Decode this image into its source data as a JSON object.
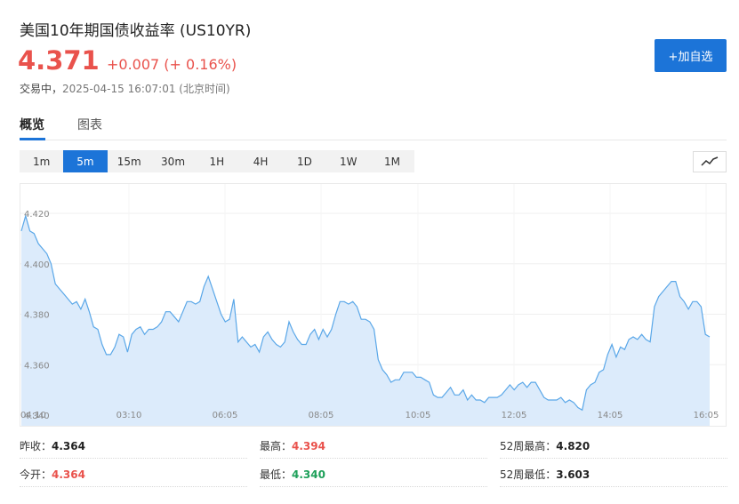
{
  "header": {
    "title": "美国10年期国债收益率  (US10YR)",
    "price": "4.371",
    "change": "+0.007 (+ 0.16%)",
    "status_prefix": "交易中，",
    "status_time": "2025-04-15 16:07:01 (北京时间)",
    "add_button": "+加自选"
  },
  "tabs": [
    {
      "label": "概览",
      "active": true
    },
    {
      "label": "图表",
      "active": false
    }
  ],
  "periods": [
    {
      "label": "1m",
      "active": false
    },
    {
      "label": "5m",
      "active": true
    },
    {
      "label": "15m",
      "active": false
    },
    {
      "label": "30m",
      "active": false
    },
    {
      "label": "1H",
      "active": false
    },
    {
      "label": "4H",
      "active": false
    },
    {
      "label": "1D",
      "active": false
    },
    {
      "label": "1W",
      "active": false
    },
    {
      "label": "1M",
      "active": false
    }
  ],
  "chart_data": {
    "type": "area",
    "color": "#5aa7e8",
    "fill": "#dcebfb",
    "ylim": [
      4.34,
      4.43
    ],
    "y_ticks": [
      "4.420",
      "4.400",
      "4.380",
      "4.360",
      "4.340"
    ],
    "x_ticks": [
      "03:10",
      "06:05",
      "08:05",
      "10:05",
      "12:05",
      "14:05",
      "16:05"
    ],
    "x_first_label": "04:10",
    "values": [
      4.413,
      4.419,
      4.413,
      4.412,
      4.408,
      4.406,
      4.404,
      4.4,
      4.392,
      4.39,
      4.388,
      4.386,
      4.384,
      4.385,
      4.382,
      4.386,
      4.381,
      4.375,
      4.374,
      4.368,
      4.364,
      4.364,
      4.367,
      4.372,
      4.371,
      4.365,
      4.372,
      4.374,
      4.375,
      4.372,
      4.374,
      4.374,
      4.375,
      4.377,
      4.381,
      4.381,
      4.379,
      4.377,
      4.381,
      4.385,
      4.385,
      4.384,
      4.385,
      4.391,
      4.395,
      4.39,
      4.385,
      4.38,
      4.377,
      4.378,
      4.386,
      4.369,
      4.371,
      4.369,
      4.367,
      4.368,
      4.365,
      4.371,
      4.373,
      4.37,
      4.368,
      4.367,
      4.369,
      4.377,
      4.373,
      4.37,
      4.368,
      4.368,
      4.372,
      4.374,
      4.37,
      4.374,
      4.371,
      4.374,
      4.38,
      4.385,
      4.385,
      4.384,
      4.385,
      4.383,
      4.378,
      4.378,
      4.377,
      4.374,
      4.362,
      4.358,
      4.356,
      4.353,
      4.354,
      4.354,
      4.357,
      4.357,
      4.357,
      4.355,
      4.355,
      4.354,
      4.353,
      4.348,
      4.347,
      4.347,
      4.349,
      4.351,
      4.348,
      4.348,
      4.35,
      4.346,
      4.348,
      4.346,
      4.346,
      4.345,
      4.347,
      4.347,
      4.347,
      4.348,
      4.35,
      4.352,
      4.35,
      4.352,
      4.353,
      4.351,
      4.353,
      4.353,
      4.35,
      4.347,
      4.346,
      4.346,
      4.346,
      4.347,
      4.345,
      4.346,
      4.345,
      4.343,
      4.342,
      4.35,
      4.352,
      4.353,
      4.357,
      4.358,
      4.364,
      4.368,
      4.363,
      4.367,
      4.366,
      4.37,
      4.371,
      4.37,
      4.372,
      4.37,
      4.369,
      4.383,
      4.387,
      4.389,
      4.391,
      4.393,
      4.393,
      4.387,
      4.385,
      4.382,
      4.385,
      4.385,
      4.383,
      4.372,
      4.371
    ]
  },
  "stats": [
    {
      "label": "昨收：",
      "value": "4.364",
      "tone": "plain"
    },
    {
      "label": "最高：",
      "value": "4.394",
      "tone": "red"
    },
    {
      "label": "52周最高：",
      "value": "4.820",
      "tone": "plain"
    },
    {
      "label": "今开：",
      "value": "4.364",
      "tone": "red"
    },
    {
      "label": "最低：",
      "value": "4.340",
      "tone": "green"
    },
    {
      "label": "52周最低：",
      "value": "3.603",
      "tone": "plain"
    }
  ]
}
